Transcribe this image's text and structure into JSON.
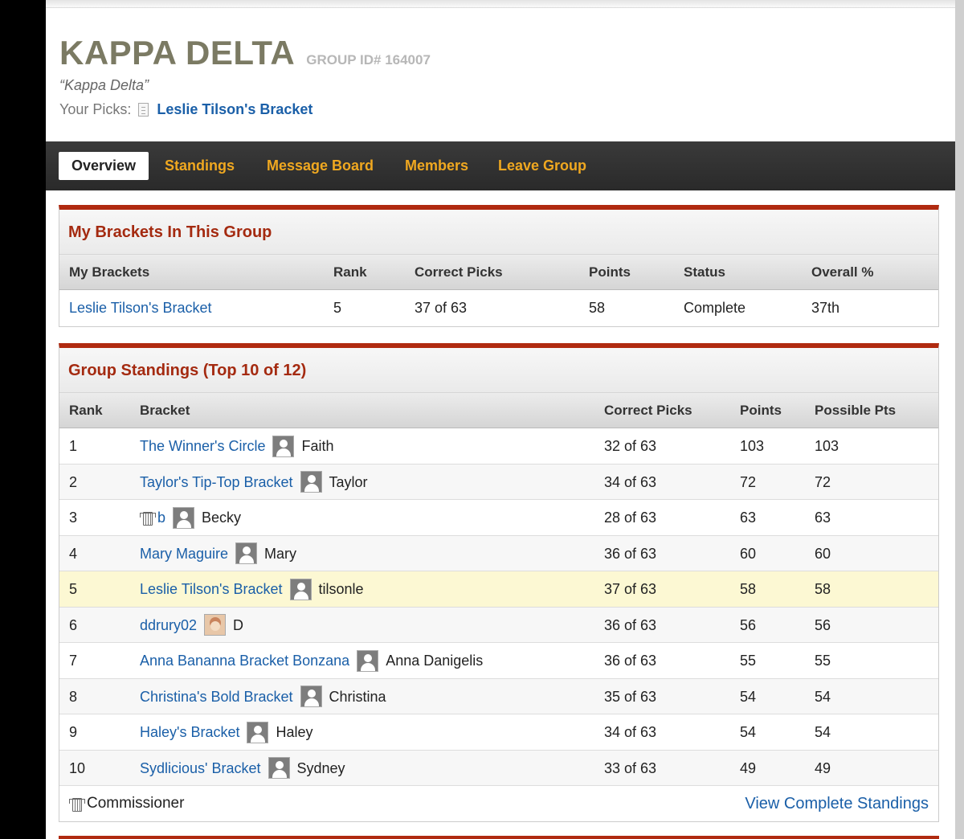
{
  "group": {
    "name": "KAPPA DELTA",
    "id_label": "GROUP ID# 164007",
    "quote": "“Kappa Delta”",
    "picks_label": "Your Picks:",
    "picks_link": "Leslie Tilson's Bracket"
  },
  "nav": {
    "tabs": [
      "Overview",
      "Standings",
      "Message Board",
      "Members",
      "Leave Group"
    ],
    "active": "Overview"
  },
  "my_brackets": {
    "title": "My Brackets In This Group",
    "columns": [
      "My Brackets",
      "Rank",
      "Correct Picks",
      "Points",
      "Status",
      "Overall %"
    ],
    "row": {
      "bracket": "Leslie Tilson's Bracket",
      "rank": "5",
      "correct": "37 of 63",
      "points": "58",
      "status": "Complete",
      "overall": "37th"
    }
  },
  "standings": {
    "title": "Group Standings (Top 10 of 12)",
    "columns": [
      "Rank",
      "Bracket",
      "Correct Picks",
      "Points",
      "Possible Pts"
    ],
    "rows": [
      {
        "rank": "1",
        "bracket": "The Winner's Circle",
        "owner": "Faith",
        "correct": "32 of 63",
        "points": "103",
        "possible": "103"
      },
      {
        "rank": "2",
        "bracket": "Taylor's Tip-Top Bracket",
        "owner": "Taylor",
        "correct": "34 of 63",
        "points": "72",
        "possible": "72"
      },
      {
        "rank": "3",
        "bracket": "b",
        "owner": "Becky",
        "correct": "28 of 63",
        "points": "63",
        "possible": "63",
        "commissioner": true
      },
      {
        "rank": "4",
        "bracket": "Mary Maguire",
        "owner": "Mary",
        "correct": "36 of 63",
        "points": "60",
        "possible": "60"
      },
      {
        "rank": "5",
        "bracket": "Leslie Tilson's Bracket",
        "owner": "tilsonle",
        "correct": "37 of 63",
        "points": "58",
        "possible": "58",
        "highlight": true
      },
      {
        "rank": "6",
        "bracket": "ddrury02",
        "owner": "D",
        "correct": "36 of 63",
        "points": "56",
        "possible": "56",
        "photo": true
      },
      {
        "rank": "7",
        "bracket": "Anna Bananna Bracket Bonzana",
        "owner": "Anna Danigelis",
        "correct": "36 of 63",
        "points": "55",
        "possible": "55"
      },
      {
        "rank": "8",
        "bracket": "Christina's Bold Bracket",
        "owner": "Christina",
        "correct": "35 of 63",
        "points": "54",
        "possible": "54"
      },
      {
        "rank": "9",
        "bracket": "Haley's Bracket",
        "owner": "Haley",
        "correct": "34 of 63",
        "points": "54",
        "possible": "54"
      },
      {
        "rank": "10",
        "bracket": "Sydlicious' Bracket",
        "owner": "Sydney",
        "correct": "33 of 63",
        "points": "49",
        "possible": "49"
      }
    ],
    "commissioner_label": "Commissioner",
    "view_all": "View Complete Standings"
  },
  "colors": {
    "accent": "#b02a10",
    "link": "#1a5fa8",
    "nav_tab": "#f0a820",
    "highlight_row": "#fcf8d3"
  },
  "icons": [
    "document-icon",
    "user-avatar-icon",
    "jersey-icon"
  ]
}
